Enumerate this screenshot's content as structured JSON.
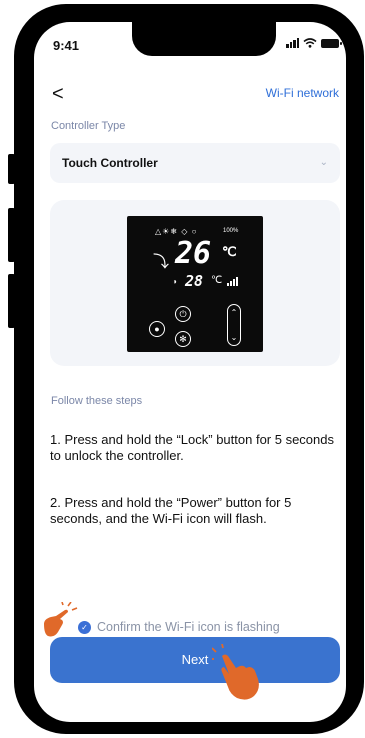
{
  "status_bar": {
    "time": "9:41"
  },
  "nav": {
    "back_symbol": "<",
    "wifi_link": "Wi-Fi network"
  },
  "controller": {
    "label": "Controller Type",
    "value": "Touch Controller"
  },
  "device_display": {
    "status_icons": "△☀❄ ◇ ○",
    "humidity": "100%",
    "set_temp": "26",
    "set_unit": "℃",
    "room_temp": "28",
    "room_unit": "℃"
  },
  "steps": {
    "heading": "Follow these steps",
    "step1": "1. Press and hold the “Lock” button for 5 seconds to unlock the controller.",
    "step2": "2. Press and hold the “Power” button for 5 seconds, and the Wi-Fi icon will flash."
  },
  "confirm": {
    "text": "Confirm the Wi-Fi icon is flashing",
    "checked": true
  },
  "next_button": {
    "label": "Next"
  },
  "colors": {
    "accent": "#3a73cf",
    "link": "#2f6fd8",
    "pointer": "#e0692a"
  },
  "icons": [
    "back-arrow-icon",
    "chevron-down-icon",
    "wifi-icon",
    "signal-icon",
    "battery-icon",
    "lock-icon",
    "power-icon",
    "fan-icon",
    "hand-pointer-icon"
  ]
}
